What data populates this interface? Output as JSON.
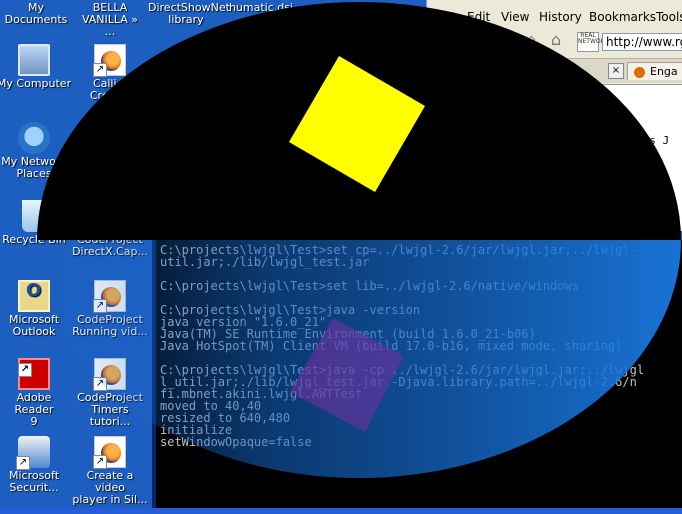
{
  "desktop": {
    "top_labels": [
      {
        "label": "My Documents"
      },
      {
        "label": "BELLA\nVANILLA » ..."
      },
      {
        "label": "DirectShowNet\nlibrary"
      },
      {
        "label": "humatic.dsj\nG..."
      }
    ],
    "icons": [
      {
        "label": "My Computer"
      },
      {
        "label": "My Network\nPlaces"
      },
      {
        "label": "Recycle Bin"
      },
      {
        "label": "Microsoft\nOutlook"
      },
      {
        "label": "Adobe Reader\n9"
      },
      {
        "label": "Microsoft\nSecurit..."
      },
      {
        "label": "Calli...\nCreat..."
      },
      {
        "label": "CodeProject\nDirectX.Cap..."
      },
      {
        "label": "CodeProject\nRunning vid..."
      },
      {
        "label": "CodeProject\nTimers tutori..."
      },
      {
        "label": "Create a video\nplayer in Sil..."
      }
    ]
  },
  "browser": {
    "menu": [
      "Edit",
      "View",
      "History",
      "Bookmarks",
      "Tools"
    ],
    "address": "http://www.rga",
    "realnetworks_badge": "REAL NETWORKS",
    "tab_label": "Enga",
    "page_snippet": "nds J"
  },
  "console": {
    "lines": [
      "C:\\projects\\lwjgl\\Test>set cp=../lwjgl-2.6/jar/lwjgl.jar;../lwjgl-",
      "util.jar;./lib/lwjgl_test.jar",
      "",
      "C:\\projects\\lwjgl\\Test>set lib=../lwjgl-2.6/native/windows",
      "",
      "C:\\projects\\lwjgl\\Test>java -version",
      "java version \"1.6.0_21\"",
      "Java(TM) SE Runtime Environment (build 1.6.0_21-b06)",
      "Java HotSpot(TM) Client VM (build 17.0-b16, mixed mode, sharing)",
      "",
      "C:\\projects\\lwjgl\\Test>java -cp ../lwjgl-2.6/jar/lwjgl.jar;../lwjgl",
      "l_util.jar;./lib/lwjgl_test.jar -Djava.library.path=../lwjgl-2.6/n",
      "fi.mbnet.akini.lwjgl.AWTTest",
      "moved to 40,40",
      "resized to 640,480",
      "initialize",
      "setWindowOpaque=false"
    ]
  },
  "overlay": {
    "colors": {
      "black": "#000000",
      "blue": "#1565c8",
      "yellow": "#ffff00",
      "purple": "#7030a0"
    }
  }
}
